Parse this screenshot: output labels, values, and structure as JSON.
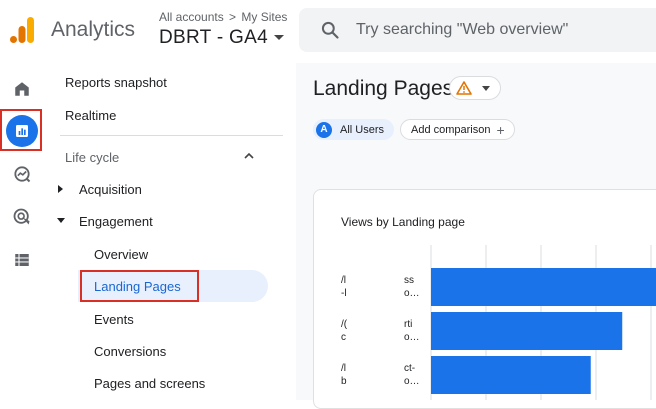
{
  "header": {
    "app_name": "Analytics",
    "breadcrumb": {
      "root": "All accounts",
      "separator": ">",
      "current": "My Sites"
    },
    "property": "DBRT - GA4",
    "search_placeholder": "Try searching \"Web overview\""
  },
  "rail": {
    "items": [
      {
        "name": "home-icon",
        "active": false
      },
      {
        "name": "reports-icon",
        "active": true
      },
      {
        "name": "explore-icon",
        "active": false
      },
      {
        "name": "advertising-icon",
        "active": false
      },
      {
        "name": "configure-icon",
        "active": false
      }
    ]
  },
  "nav": {
    "reports_snapshot": "Reports snapshot",
    "realtime": "Realtime",
    "section": "Life cycle",
    "acquisition": "Acquisition",
    "engagement": "Engagement",
    "sub": {
      "overview": "Overview",
      "landing_pages": "Landing Pages",
      "events": "Events",
      "conversions": "Conversions",
      "pages_screens": "Pages and screens"
    }
  },
  "main": {
    "title": "Landing Pages",
    "segment_badge": "A",
    "segment": "All Users",
    "add_comparison": "Add comparison",
    "card_title": "Views by Landing page"
  },
  "chart_data": {
    "type": "bar",
    "orientation": "horizontal",
    "title": "Views by Landing page",
    "rows": [
      {
        "label_left": "/l\n-l",
        "label_right": "ss\no…"
      },
      {
        "label_left": "/(\nc",
        "label_right": "rti\no…"
      },
      {
        "label_left": "/l\nb",
        "label_right": "ct-\no…"
      }
    ],
    "values_relative": [
      1.0,
      0.85,
      0.71
    ],
    "colors": {
      "bar": "#1a73e8",
      "grid": "#dadce0"
    }
  },
  "colors": {
    "accent": "#1a73e8",
    "highlight_border": "#d93025",
    "warning": "#e37400"
  }
}
